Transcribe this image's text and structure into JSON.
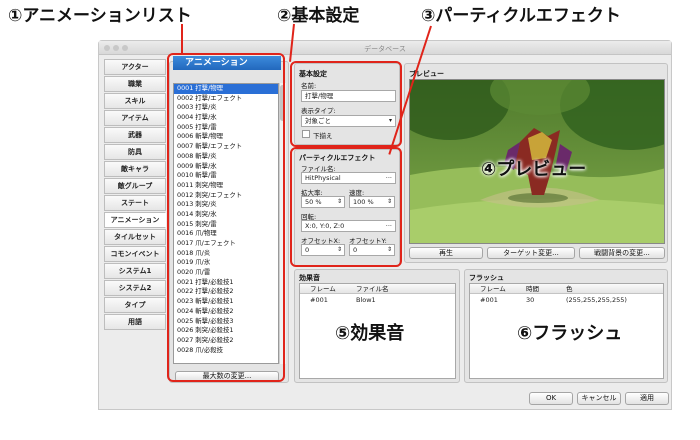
{
  "callouts": {
    "c1": "①アニメーションリスト",
    "c2": "②基本設定",
    "c3": "③パーティクルエフェクト",
    "c4": "④プレビュー",
    "c5": "⑤効果音",
    "c6": "⑥フラッシュ"
  },
  "window": {
    "title": "データベース"
  },
  "sidebar": {
    "items": [
      "アクター",
      "職業",
      "スキル",
      "アイテム",
      "武器",
      "防具",
      "敵キャラ",
      "敵グループ",
      "ステート",
      "アニメーション",
      "タイルセット",
      "コモンイベント",
      "システム1",
      "システム2",
      "タイプ",
      "用語"
    ],
    "active_index": 9
  },
  "list": {
    "header": "アニメーション",
    "items": [
      "0001 打撃/物理",
      "0002 打撃/エフェクト",
      "0003 打撃/炎",
      "0004 打撃/氷",
      "0005 打撃/雷",
      "0006 斬撃/物理",
      "0007 斬撃/エフェクト",
      "0008 斬撃/炎",
      "0009 斬撃/氷",
      "0010 斬撃/雷",
      "0011 刺突/物理",
      "0012 刺突/エフェクト",
      "0013 刺突/炎",
      "0014 刺突/氷",
      "0015 刺突/雷",
      "0016 爪/物理",
      "0017 爪/エフェクト",
      "0018 爪/炎",
      "0019 爪/氷",
      "0020 爪/雷",
      "0021 打撃/必殺技1",
      "0022 打撃/必殺技2",
      "0023 斬撃/必殺技1",
      "0024 斬撃/必殺技2",
      "0025 斬撃/必殺技3",
      "0026 刺突/必殺技1",
      "0027 刺突/必殺技2",
      "0028 爪/必殺技"
    ],
    "selected_index": 0,
    "max_button": "最大数の変更..."
  },
  "basic": {
    "title": "基本設定",
    "name_label": "名前:",
    "name_value": "打撃/物理",
    "display_label": "表示タイプ:",
    "display_value": "対象ごと",
    "flip_label": "下揃え"
  },
  "particle": {
    "title": "パーティクルエフェクト",
    "file_label": "ファイル名:",
    "file_value": "HitPhysical",
    "scale_label": "拡大率:",
    "scale_value": "50 %",
    "speed_label": "速度:",
    "speed_value": "100 %",
    "rotation_label": "回転:",
    "rotation_value": "X:0, Y:0, Z:0",
    "offx_label": "オフセットX:",
    "offx_value": "0",
    "offy_label": "オフセットY:",
    "offy_value": "0"
  },
  "preview": {
    "title": "プレビュー",
    "play_button": "再生",
    "target_button": "ターゲット変更...",
    "bg_button": "戦闘背景の変更..."
  },
  "se": {
    "title": "効果音",
    "col_frame": "フレーム",
    "col_file": "ファイル名",
    "rows": [
      {
        "frame": "#001",
        "file": "Blow1"
      }
    ]
  },
  "flash": {
    "title": "フラッシュ",
    "col_frame": "フレーム",
    "col_time": "時間",
    "col_color": "色",
    "rows": [
      {
        "frame": "#001",
        "time": "30",
        "color": "(255,255,255,255)"
      }
    ]
  },
  "footer": {
    "ok": "OK",
    "cancel": "キャンセル",
    "apply": "適用"
  },
  "colors": {
    "accent": "#2a6fd6",
    "callout_border": "#e0241a"
  }
}
